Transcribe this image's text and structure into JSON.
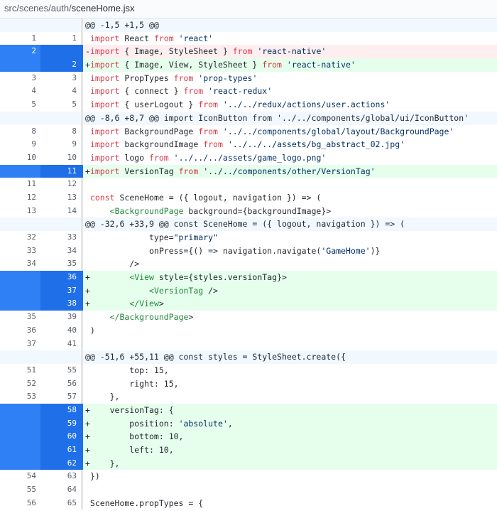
{
  "file": {
    "dir": "src/scenes/auth/",
    "name": "sceneHome.jsx"
  },
  "lines": [
    {
      "type": "hunk",
      "old": "",
      "new": "",
      "text": "@@ -1,5 +1,5 @@"
    },
    {
      "type": "ctx",
      "old": "1",
      "new": "1",
      "text": " import React from 'react'"
    },
    {
      "type": "del",
      "old": "2",
      "new": "",
      "text": "-import { Image, StyleSheet } from 'react-native'"
    },
    {
      "type": "add",
      "old": "",
      "new": "2",
      "text": "+import { Image, View, StyleSheet } from 'react-native'"
    },
    {
      "type": "ctx",
      "old": "3",
      "new": "3",
      "text": " import PropTypes from 'prop-types'"
    },
    {
      "type": "ctx",
      "old": "4",
      "new": "4",
      "text": " import { connect } from 'react-redux'"
    },
    {
      "type": "ctx",
      "old": "5",
      "new": "5",
      "text": " import { userLogout } from '../../redux/actions/user.actions'"
    },
    {
      "type": "hunk",
      "old": "",
      "new": "",
      "text": "@@ -8,6 +8,7 @@ import IconButton from '../../components/global/ui/IconButton'"
    },
    {
      "type": "ctx",
      "old": "8",
      "new": "8",
      "text": " import BackgroundPage from '../../components/global/layout/BackgroundPage'"
    },
    {
      "type": "ctx",
      "old": "9",
      "new": "9",
      "text": " import backgroundImage from '../../../assets/bg_abstract_02.jpg'"
    },
    {
      "type": "ctx",
      "old": "10",
      "new": "10",
      "text": " import logo from '../../../assets/game_logo.png'"
    },
    {
      "type": "add",
      "old": "",
      "new": "11",
      "text": "+import VersionTag from '../../components/other/VersionTag'"
    },
    {
      "type": "ctx",
      "old": "11",
      "new": "12",
      "text": " "
    },
    {
      "type": "ctx",
      "old": "12",
      "new": "13",
      "text": " const SceneHome = ({ logout, navigation }) => ("
    },
    {
      "type": "ctx",
      "old": "13",
      "new": "14",
      "text": "     <BackgroundPage background={backgroundImage}>"
    },
    {
      "type": "hunk",
      "old": "",
      "new": "",
      "text": "@@ -32,6 +33,9 @@ const SceneHome = ({ logout, navigation }) => ("
    },
    {
      "type": "ctx",
      "old": "32",
      "new": "33",
      "text": "             type=\"primary\""
    },
    {
      "type": "ctx",
      "old": "33",
      "new": "34",
      "text": "             onPress={() => navigation.navigate('GameHome')}"
    },
    {
      "type": "ctx",
      "old": "34",
      "new": "35",
      "text": "         />"
    },
    {
      "type": "add",
      "old": "",
      "new": "36",
      "text": "+        <View style={styles.versionTag}>"
    },
    {
      "type": "add",
      "old": "",
      "new": "37",
      "text": "+            <VersionTag />"
    },
    {
      "type": "add",
      "old": "",
      "new": "38",
      "text": "+        </View>"
    },
    {
      "type": "ctx",
      "old": "35",
      "new": "39",
      "text": "     </BackgroundPage>"
    },
    {
      "type": "ctx",
      "old": "36",
      "new": "40",
      "text": " )"
    },
    {
      "type": "ctx",
      "old": "37",
      "new": "41",
      "text": " "
    },
    {
      "type": "hunk",
      "old": "",
      "new": "",
      "text": "@@ -51,6 +55,11 @@ const styles = StyleSheet.create({"
    },
    {
      "type": "ctx",
      "old": "51",
      "new": "55",
      "text": "         top: 15,"
    },
    {
      "type": "ctx",
      "old": "52",
      "new": "56",
      "text": "         right: 15,"
    },
    {
      "type": "ctx",
      "old": "53",
      "new": "57",
      "text": "     },"
    },
    {
      "type": "add",
      "old": "",
      "new": "58",
      "text": "+    versionTag: {"
    },
    {
      "type": "add",
      "old": "",
      "new": "59",
      "text": "+        position: 'absolute',"
    },
    {
      "type": "add",
      "old": "",
      "new": "60",
      "text": "+        bottom: 10,"
    },
    {
      "type": "add",
      "old": "",
      "new": "61",
      "text": "+        left: 10,"
    },
    {
      "type": "add",
      "old": "",
      "new": "62",
      "text": "+    },"
    },
    {
      "type": "ctx",
      "old": "54",
      "new": "63",
      "text": " })"
    },
    {
      "type": "ctx",
      "old": "55",
      "new": "64",
      "text": " "
    },
    {
      "type": "ctx",
      "old": "56",
      "new": "65",
      "text": " SceneHome.propTypes = {"
    }
  ],
  "colors": {
    "add_bg": "#e6ffed",
    "del_bg": "#ffeef0",
    "hunk_bg": "#f1f8ff",
    "selected_gutter": "#2f7ff5"
  }
}
